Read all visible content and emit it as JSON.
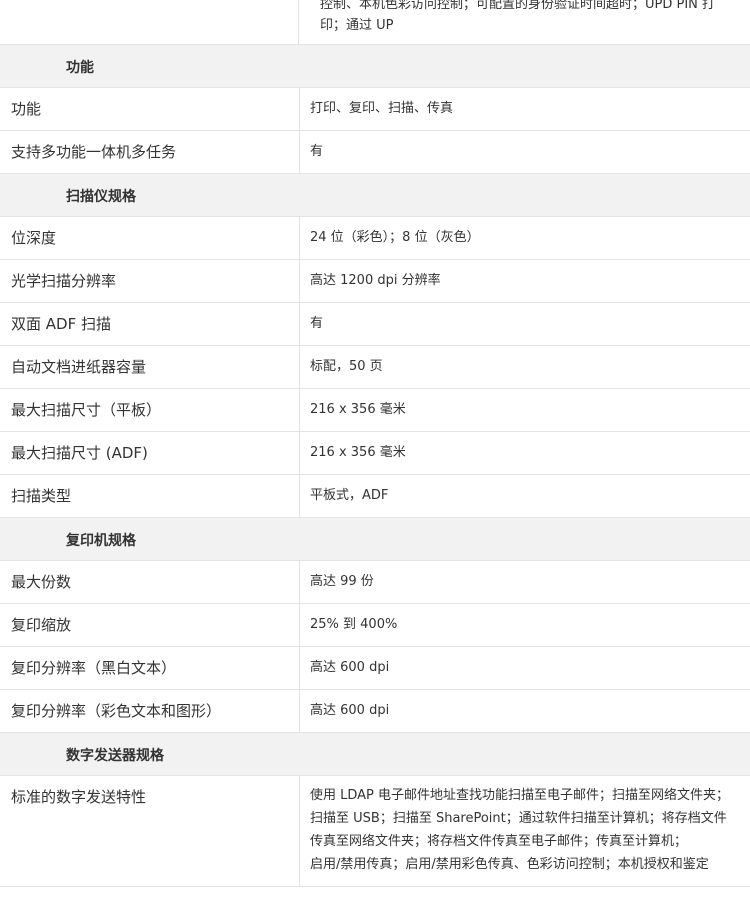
{
  "top_fragment": {
    "line1": "控制、本机色彩访问控制；可配置的身份验证时间超时；UPD PIN 打",
    "line2": "印；通过 UP"
  },
  "sections": {
    "functions": {
      "title": "功能",
      "rows": [
        {
          "label": "功能",
          "value": "打印、复印、扫描、传真"
        },
        {
          "label": "支持多功能一体机多任务",
          "value": "有"
        }
      ]
    },
    "scanner": {
      "title": "扫描仪规格",
      "rows": [
        {
          "label": "位深度",
          "value": "24 位（彩色）；8 位（灰色）"
        },
        {
          "label": "光学扫描分辨率",
          "value": "高达 1200 dpi 分辨率"
        },
        {
          "label": "双面 ADF 扫描",
          "value": "有"
        },
        {
          "label": "自动文档进纸器容量",
          "value": "标配，50 页"
        },
        {
          "label": "最大扫描尺寸（平板）",
          "value": "216 x 356 毫米"
        },
        {
          "label": "最大扫描尺寸 (ADF)",
          "value": "216 x 356 毫米"
        },
        {
          "label": "扫描类型",
          "value": "平板式，ADF"
        }
      ]
    },
    "copier": {
      "title": "复印机规格",
      "rows": [
        {
          "label": "最大份数",
          "value": "高达 99 份"
        },
        {
          "label": "复印缩放",
          "value": "25% 到 400%"
        },
        {
          "label": "复印分辨率（黑白文本）",
          "value": "高达 600 dpi"
        },
        {
          "label": "复印分辨率（彩色文本和图形）",
          "value": "高达 600 dpi"
        }
      ]
    },
    "digital_sender": {
      "title": "数字发送器规格",
      "rows": [
        {
          "label": "标准的数字发送特性",
          "value_lines": [
            "使用 LDAP 电子邮件地址查找功能扫描至电子邮件；扫描至网络文件夹；",
            "扫描至 USB；扫描至 SharePoint；通过软件扫描至计算机；将存档文件",
            "传真至网络文件夹；将存档文件传真至电子邮件；传真至计算机；",
            "启用/禁用传真；启用/禁用彩色传真、色彩访问控制；本机授权和鉴定"
          ]
        }
      ]
    }
  }
}
